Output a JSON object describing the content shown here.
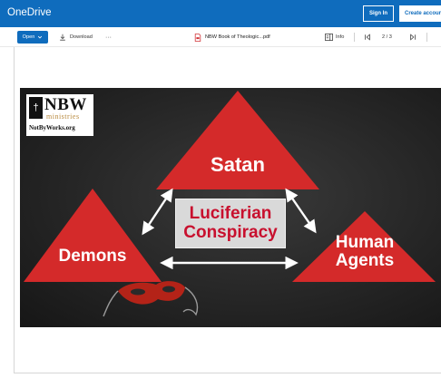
{
  "app": {
    "title": "OneDrive",
    "accent": "#0f6cbd"
  },
  "header": {
    "signin_label": "Sign In",
    "create_label": "Create account"
  },
  "toolbar": {
    "open_label": "Open",
    "download_label": "Download",
    "more_label": "···",
    "filename": "NBW Book of Theologic...pdf",
    "info_label": "Info",
    "page_current": "2",
    "page_total": "3",
    "icons": [
      "chevron-down-icon",
      "download-icon",
      "pdf-file-icon",
      "info-panel-icon",
      "first-page-icon",
      "last-page-icon"
    ]
  },
  "slide": {
    "logo": {
      "name": "NBW",
      "subtitle": "ministries",
      "url": "NotByWorks.org"
    },
    "top_label": "Satan",
    "center_label_line1": "Luciferian",
    "center_label_line2": "Conspiracy",
    "left_label": "Demons",
    "right_label_line1": "Human",
    "right_label_line2": "Agents",
    "colors": {
      "triangle": "#d42a2a",
      "center_text": "#c8102e",
      "center_box": "#d9d9d9",
      "background": "#262626"
    }
  }
}
